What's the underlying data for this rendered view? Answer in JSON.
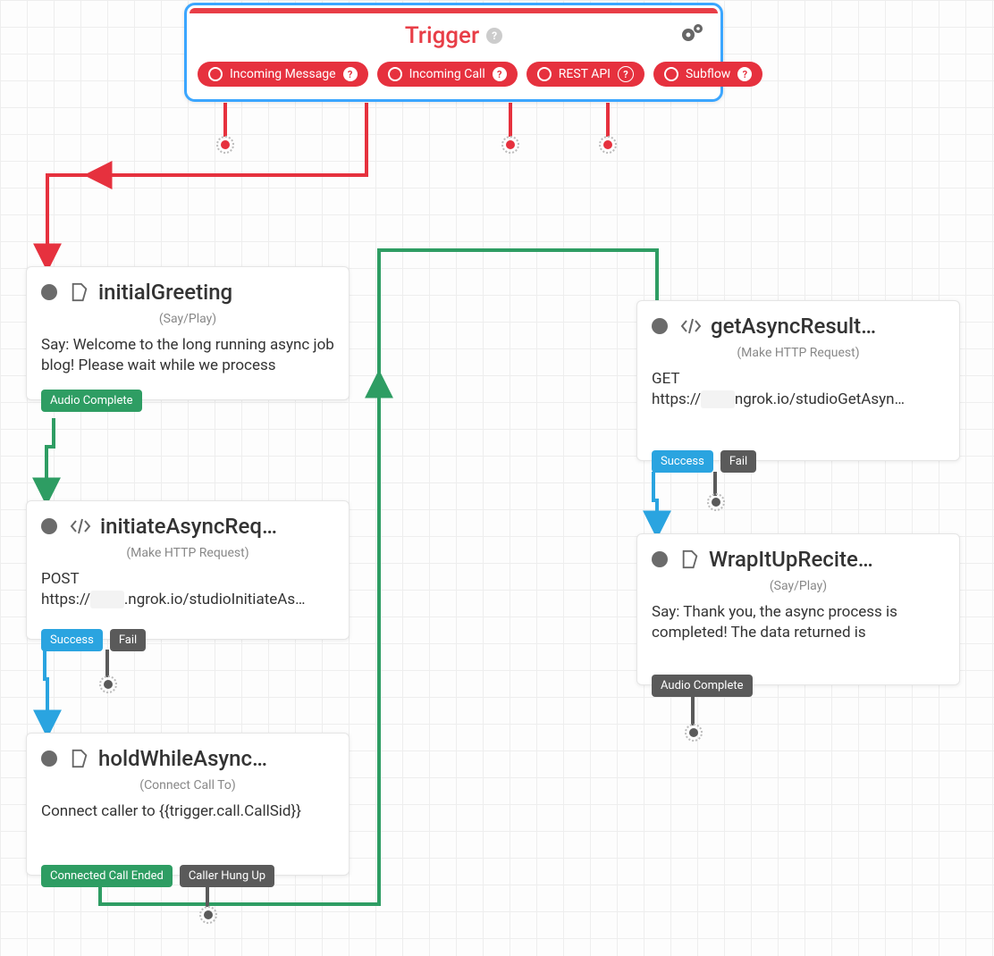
{
  "trigger": {
    "title": "Trigger",
    "pills": {
      "incoming_message": "Incoming Message",
      "incoming_call": "Incoming Call",
      "rest_api": "REST API",
      "subflow": "Subflow"
    }
  },
  "nodes": {
    "initialGreeting": {
      "title": "initialGreeting",
      "subtitle": "(Say/Play)",
      "body": "Say: Welcome to the long running async job blog! Please wait while we process",
      "outputs": {
        "audio_complete": "Audio Complete"
      }
    },
    "initiateAsyncReq": {
      "title": "initiateAsyncReq…",
      "subtitle": "(Make HTTP Request)",
      "body_prefix": "POST\nhttps://",
      "body_hidden": "xxxx",
      "body_suffix": ".ngrok.io/studioInitiateAs…",
      "outputs": {
        "success": "Success",
        "fail": "Fail"
      }
    },
    "holdWhileAsync": {
      "title": "holdWhileAsync…",
      "subtitle": "(Connect Call To)",
      "body": "Connect caller to {{trigger.call.CallSid}}",
      "outputs": {
        "connected_ended": "Connected Call Ended",
        "caller_hung_up": "Caller Hung Up"
      }
    },
    "getAsyncResult": {
      "title": "getAsyncResult…",
      "subtitle": "(Make HTTP Request)",
      "body_prefix": "GET\nhttps://",
      "body_hidden": "xxxx",
      "body_suffix": "ngrok.io/studioGetAsyn…",
      "outputs": {
        "success": "Success",
        "fail": "Fail"
      }
    },
    "wrapItUp": {
      "title": "WrapItUpRecite…",
      "subtitle": "(Say/Play)",
      "body": "Say: Thank you, the async process is completed! The data returned is",
      "outputs": {
        "audio_complete": "Audio Complete"
      }
    }
  },
  "colors": {
    "red": "#e6313e",
    "green": "#2e9d63",
    "blue": "#2aa4e0",
    "grey": "#5a5a5a"
  }
}
